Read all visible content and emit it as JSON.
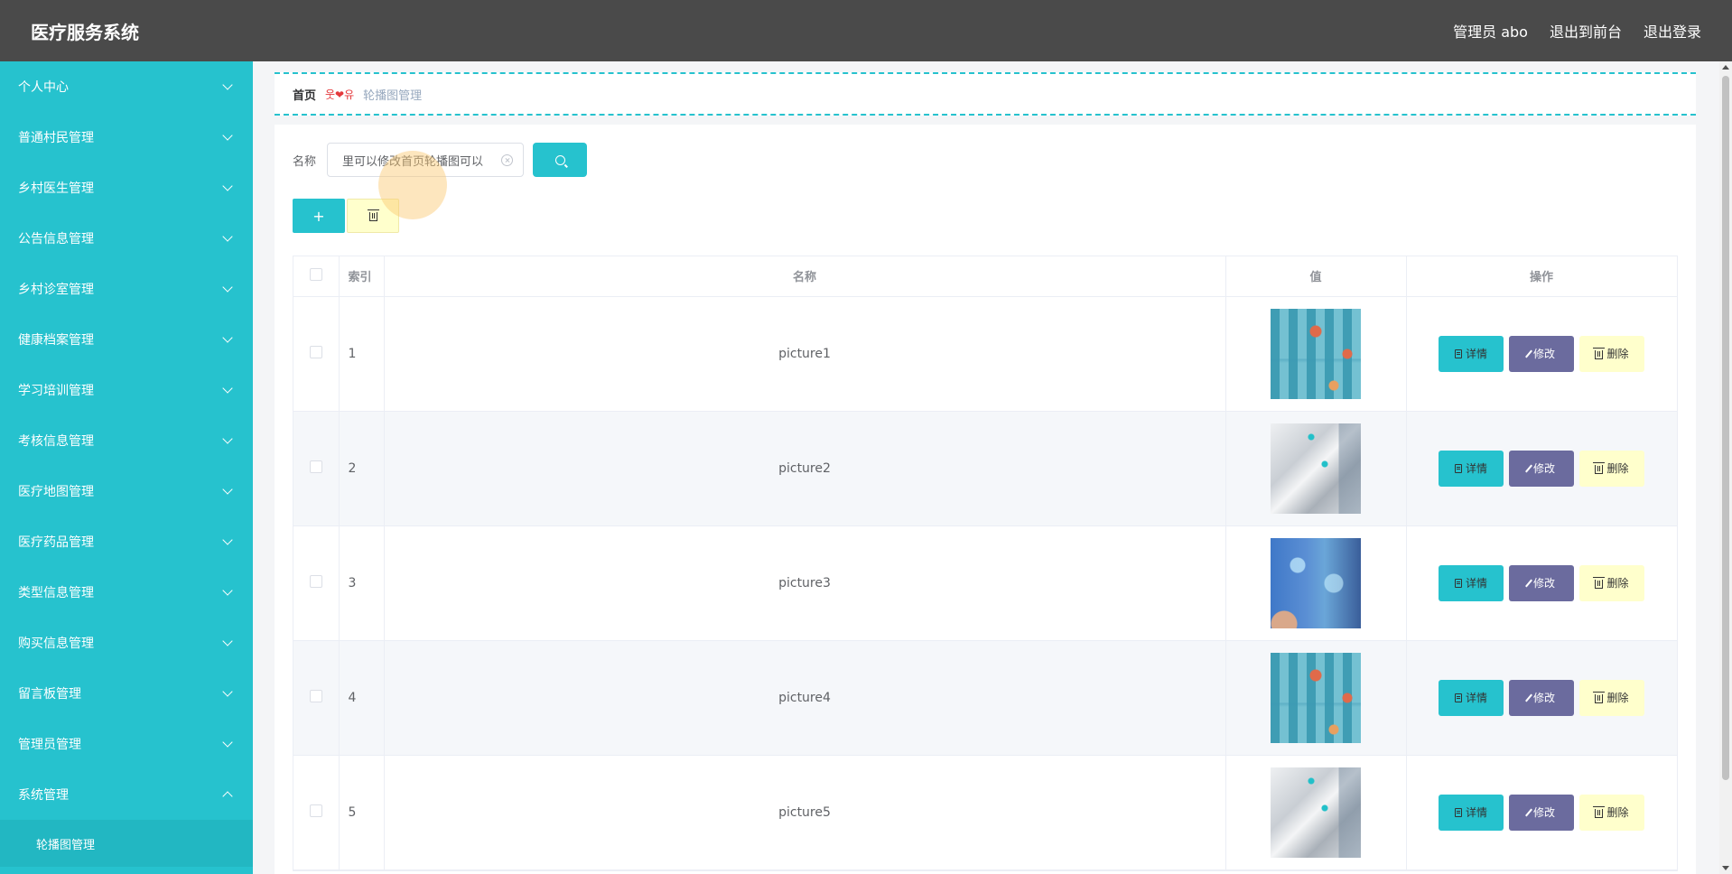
{
  "app": {
    "title": "医疗服务系统"
  },
  "header": {
    "user_label": "管理员 abo",
    "front_label": "退出到前台",
    "logout_label": "退出登录"
  },
  "sidebar": {
    "items": [
      {
        "label": "个人中心"
      },
      {
        "label": "普通村民管理"
      },
      {
        "label": "乡村医生管理"
      },
      {
        "label": "公告信息管理"
      },
      {
        "label": "乡村诊室管理"
      },
      {
        "label": "健康档案管理"
      },
      {
        "label": "学习培训管理"
      },
      {
        "label": "考核信息管理"
      },
      {
        "label": "医疗地图管理"
      },
      {
        "label": "医疗药品管理"
      },
      {
        "label": "类型信息管理"
      },
      {
        "label": "购买信息管理"
      },
      {
        "label": "留言板管理"
      },
      {
        "label": "管理员管理"
      },
      {
        "label": "系统管理"
      }
    ],
    "sub_item": "轮播图管理"
  },
  "breadcrumb": {
    "home": "首页",
    "separator": "웃❤유",
    "current": "轮播图管理"
  },
  "search": {
    "label": "名称",
    "value": "里可以修改首页轮播图可以"
  },
  "actions": {
    "add_label": "+"
  },
  "table": {
    "headers": {
      "index": "索引",
      "name": "名称",
      "value": "值",
      "ops": "操作"
    },
    "rows": [
      {
        "index": "1",
        "name": "picture1"
      },
      {
        "index": "2",
        "name": "picture2"
      },
      {
        "index": "3",
        "name": "picture3"
      },
      {
        "index": "4",
        "name": "picture4"
      },
      {
        "index": "5",
        "name": "picture5"
      }
    ],
    "ops": {
      "detail": "详情",
      "edit": "修改",
      "delete": "删除"
    }
  },
  "colors": {
    "accent": "#26c2ce",
    "edit": "#6b6b9e",
    "delete": "#ffffcc",
    "header": "#4a4a4a"
  }
}
